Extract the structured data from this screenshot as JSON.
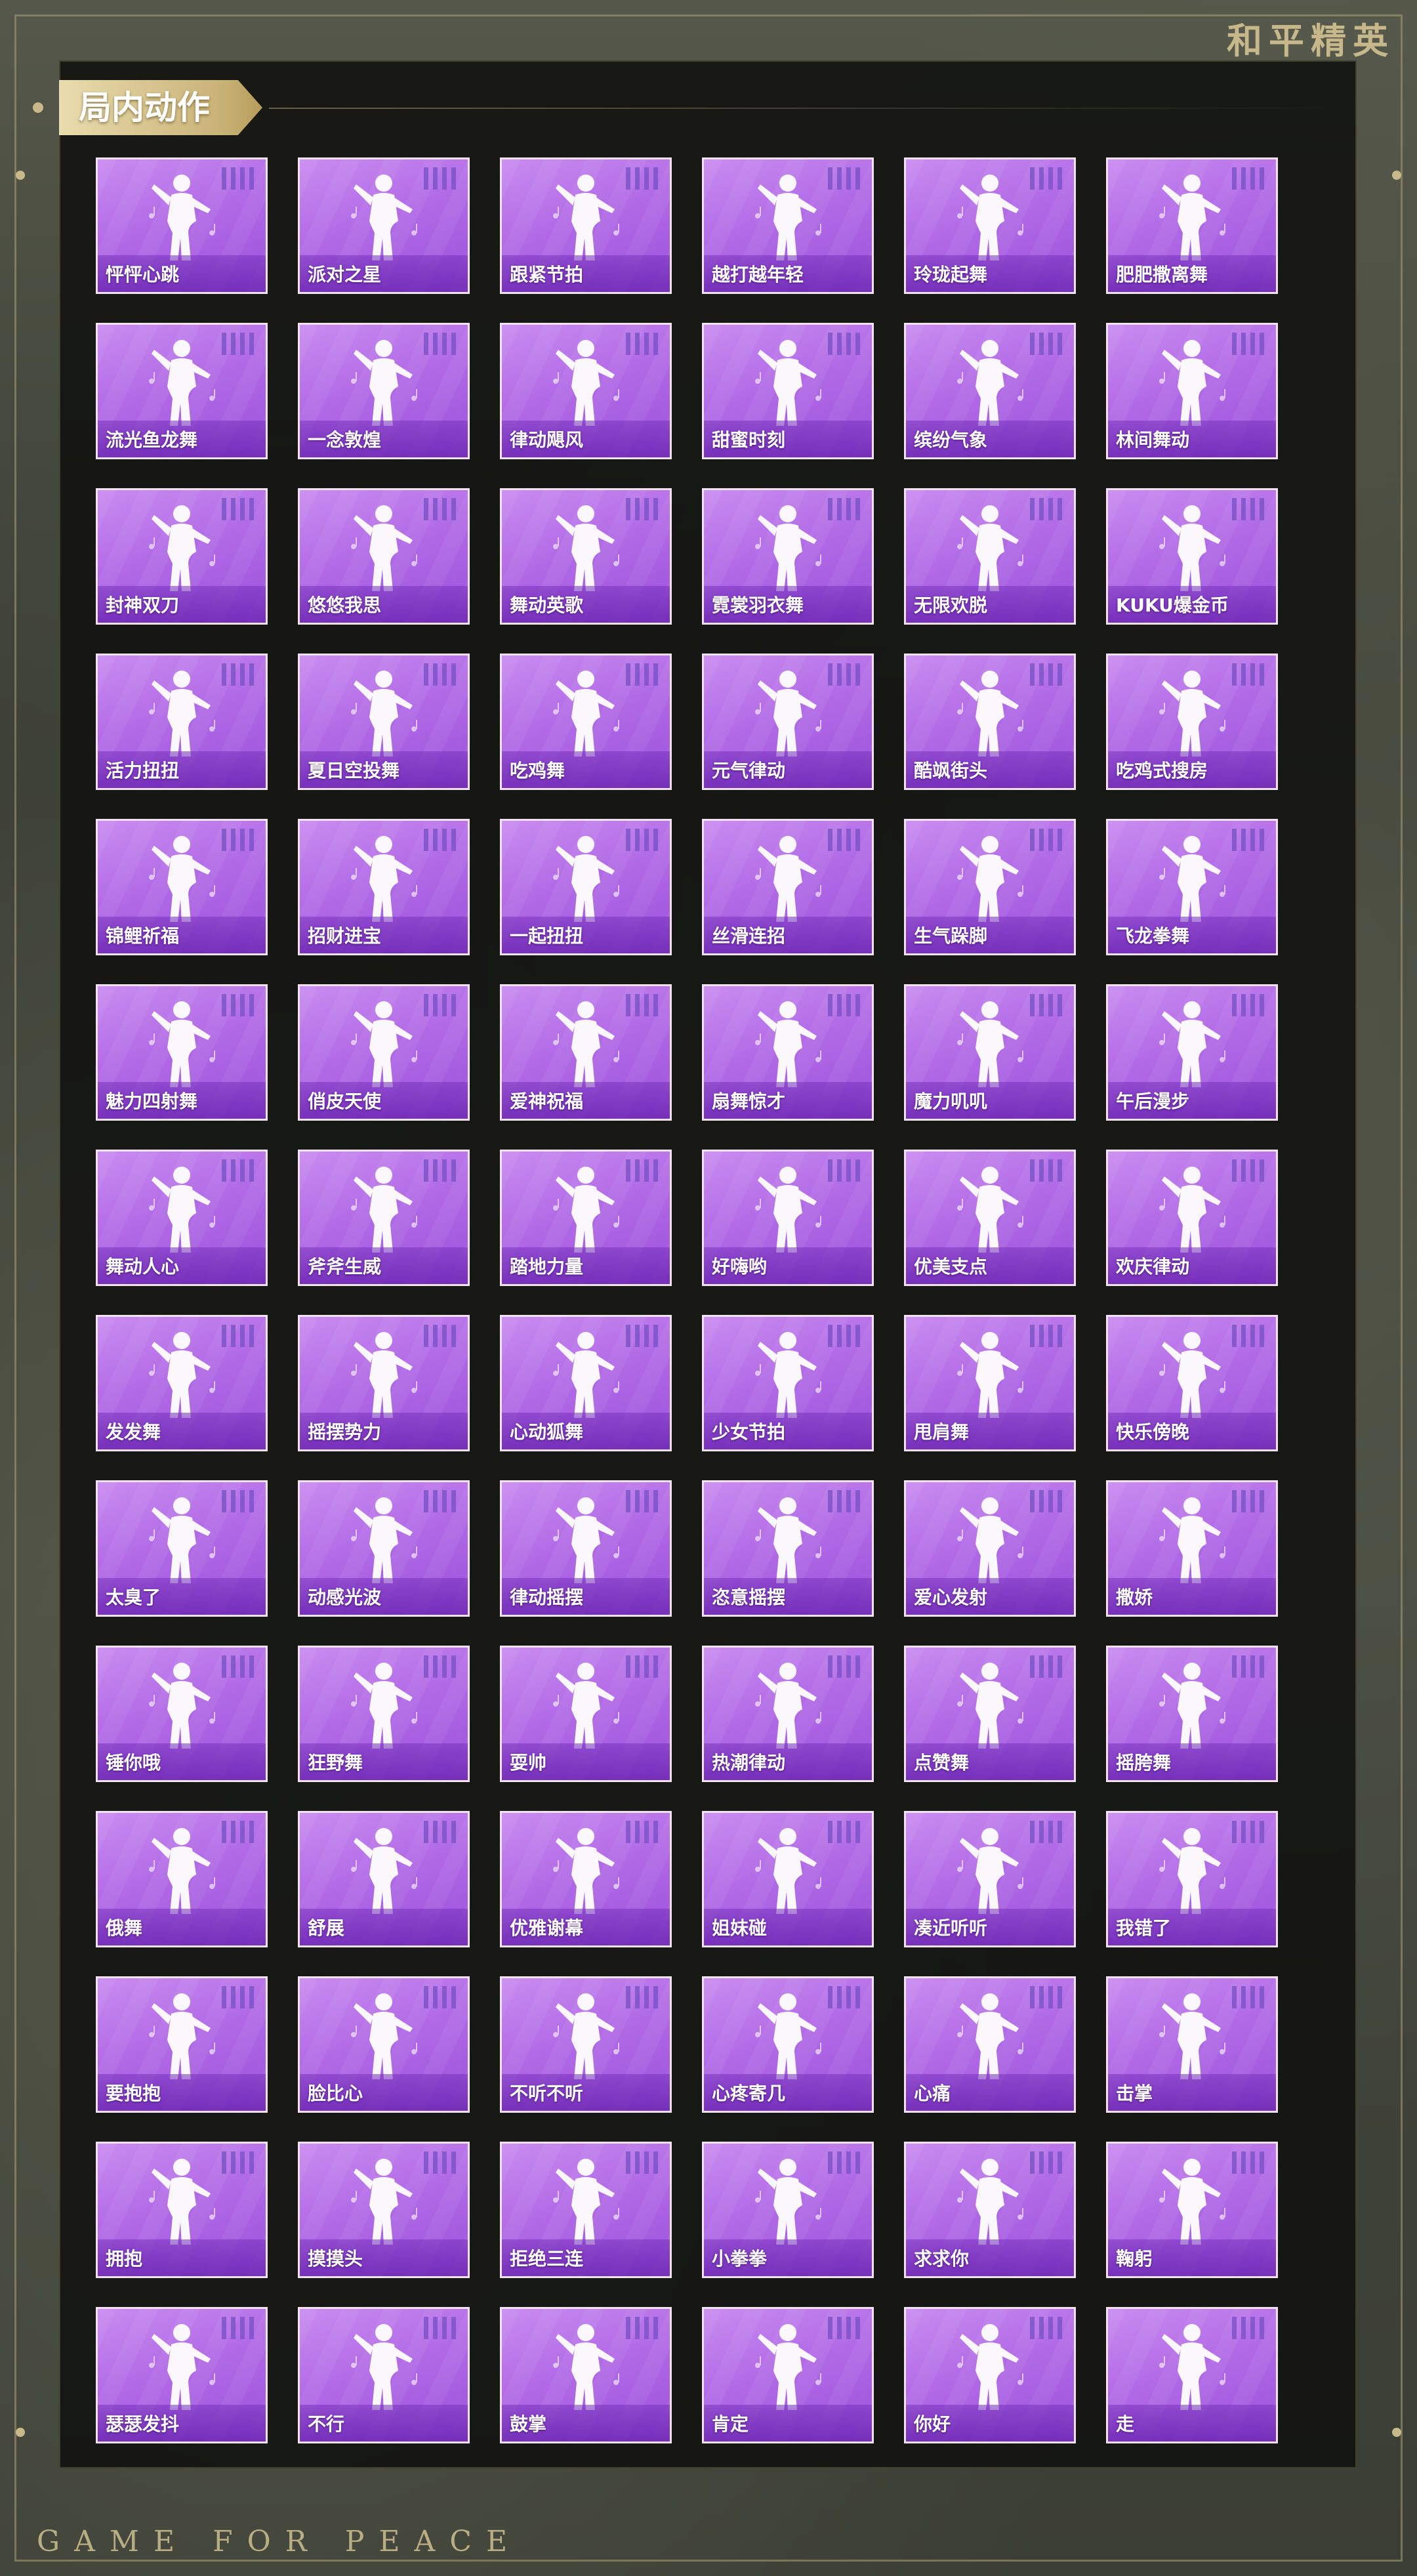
{
  "brand": {
    "logo_text": "和平精英",
    "footer_text": "GAME FOR PEACE"
  },
  "section": {
    "title": "局内动作"
  },
  "actions": [
    "怦怦心跳",
    "派对之星",
    "跟紧节拍",
    "越打越年轻",
    "玲珑起舞",
    "肥肥撒离舞",
    "流光鱼龙舞",
    "一念敦煌",
    "律动飓风",
    "甜蜜时刻",
    "缤纷气象",
    "林间舞动",
    "封神双刀",
    "悠悠我思",
    "舞动英歌",
    "霓裳羽衣舞",
    "无限欢脱",
    "KUKU爆金币",
    "活力扭扭",
    "夏日空投舞",
    "吃鸡舞",
    "元气律动",
    "酷飒街头",
    "吃鸡式搜房",
    "锦鲤祈福",
    "招财进宝",
    "一起扭扭",
    "丝滑连招",
    "生气跺脚",
    "飞龙拳舞",
    "魅力四射舞",
    "俏皮天使",
    "爱神祝福",
    "扇舞惊才",
    "魔力叽叽",
    "午后漫步",
    "舞动人心",
    "斧斧生威",
    "踏地力量",
    "好嗨哟",
    "优美支点",
    "欢庆律动",
    "发发舞",
    "摇摆势力",
    "心动狐舞",
    "少女节拍",
    "甩肩舞",
    "快乐傍晚",
    "太臭了",
    "动感光波",
    "律动摇摆",
    "恣意摇摆",
    "爱心发射",
    "撒娇",
    "锤你哦",
    "狂野舞",
    "耍帅",
    "热潮律动",
    "点赞舞",
    "摇胯舞",
    "俄舞",
    "舒展",
    "优雅谢幕",
    "姐妹碰",
    "凑近听听",
    "我错了",
    "要抱抱",
    "脸比心",
    "不听不听",
    "心疼寄几",
    "心痛",
    "击掌",
    "拥抱",
    "摸摸头",
    "拒绝三连",
    "小拳拳",
    "求求你",
    "鞠躬",
    "瑟瑟发抖",
    "不行",
    "鼓掌",
    "肯定",
    "你好",
    "走"
  ]
}
